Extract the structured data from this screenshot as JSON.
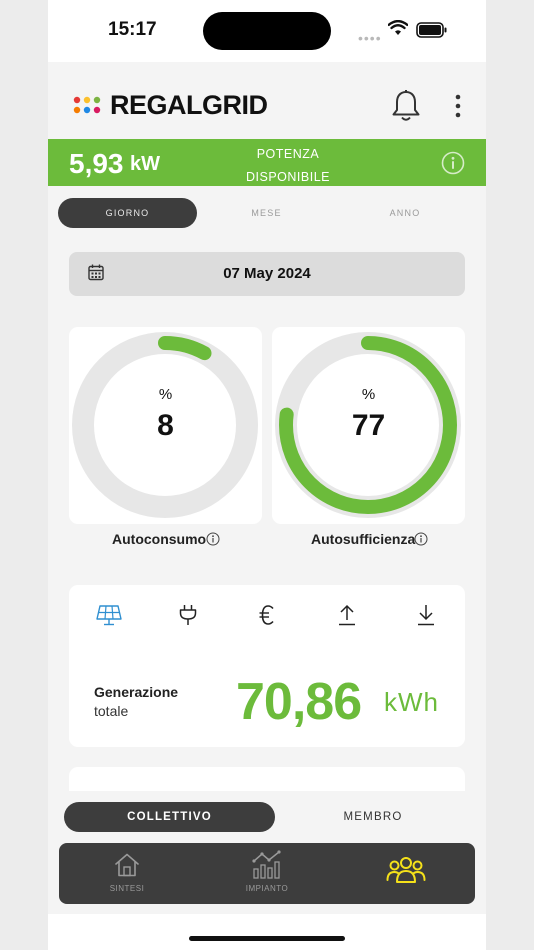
{
  "status_bar": {
    "time": "15:17"
  },
  "brand": {
    "logo_text": "REGALGRID",
    "accent": "#6cbb3b"
  },
  "banner": {
    "power_value": "5,93",
    "power_unit": "kW",
    "label_line1": "POTENZA",
    "label_line2": "DISPONIBILE"
  },
  "period_tabs": {
    "items": [
      "GIORNO",
      "MESE",
      "ANNO"
    ],
    "selected": "GIORNO"
  },
  "date": {
    "value": "07 May 2024"
  },
  "gauges": [
    {
      "label": "Autoconsumo",
      "unit": "%",
      "value": "8",
      "fraction": 0.08
    },
    {
      "label": "Autosufficienza",
      "unit": "%",
      "value": "77",
      "fraction": 0.77
    }
  ],
  "energy": {
    "icons": [
      "solar-panel-icon",
      "plug-icon",
      "euro-icon",
      "upload-arrow-icon",
      "download-arrow-icon"
    ],
    "selected_icon": "solar-panel-icon",
    "title": "Generazione",
    "subtitle": "totale",
    "value": "70,86",
    "unit": "kWh"
  },
  "scope_tabs": {
    "items": [
      "COLLETTIVO",
      "MEMBRO"
    ],
    "selected": "COLLETTIVO"
  },
  "tabbar": {
    "items": [
      {
        "label": "SINTESI",
        "icon": "house-icon"
      },
      {
        "label": "IMPIANTO",
        "icon": "chart-icon"
      },
      {
        "label": "",
        "icon": "community-icon"
      }
    ],
    "active_color": "#f5e11a"
  }
}
